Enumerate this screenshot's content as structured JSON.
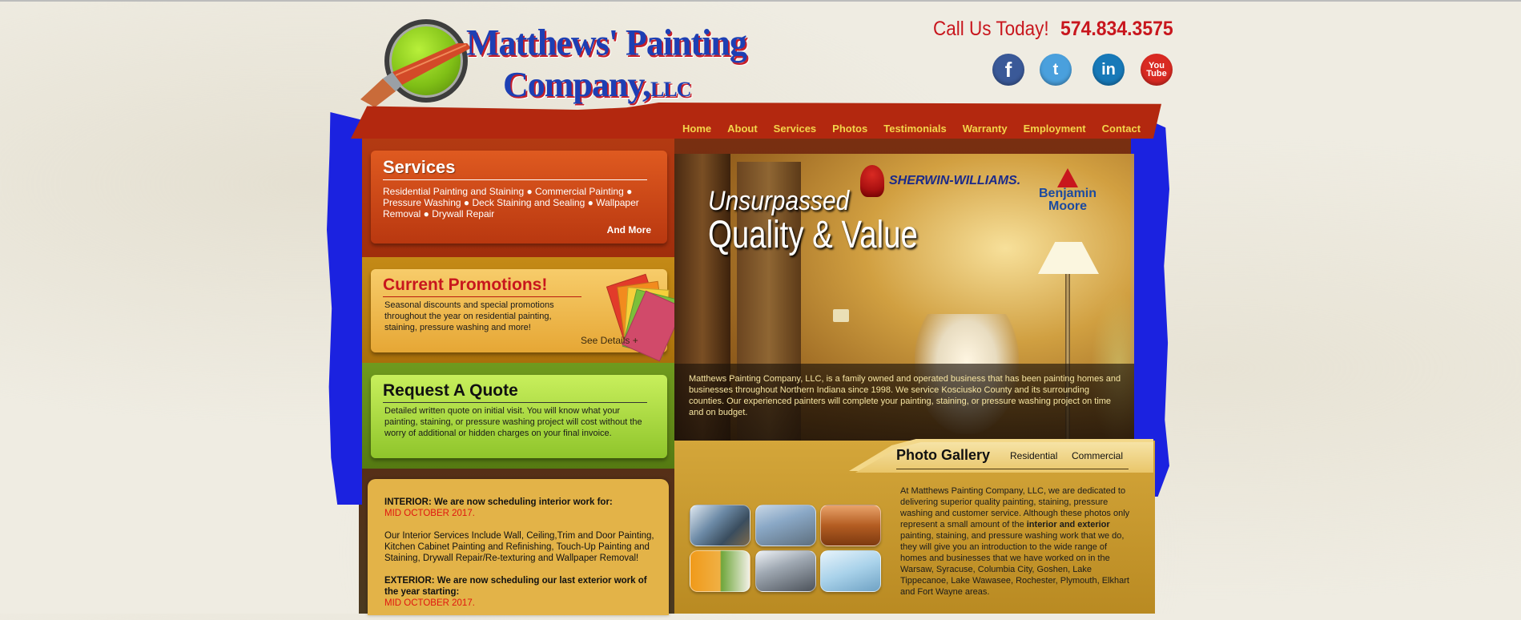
{
  "logo": {
    "line1": "Matthews' Painting",
    "line2": "Company,",
    "llc": "LLC"
  },
  "header": {
    "call_label": "Call Us Today!",
    "phone": "574.834.3575",
    "social": {
      "facebook": "f",
      "twitter": "t",
      "linkedin": "in",
      "youtube_top": "You",
      "youtube_bottom": "Tube"
    }
  },
  "nav": {
    "items": [
      "Home",
      "About",
      "Services",
      "Photos",
      "Testimonials",
      "Warranty",
      "Employment",
      "Contact"
    ]
  },
  "services": {
    "title": "Services",
    "text": "Residential Painting and Staining ● Commercial Painting ● Pressure Washing ● Deck Staining and Sealing ● Wallpaper Removal ● Drywall Repair",
    "more": "And More"
  },
  "promotions": {
    "title": "Current Promotions!",
    "text": "Seasonal discounts and special promotions throughout the year on residential painting, staining, pressure washing and more!",
    "more": "See Details +"
  },
  "quote": {
    "title": "Request A Quote",
    "text": "Detailed written quote on initial visit. You will know what your painting, staining, or pressure washing project will cost without the worry of additional or hidden charges on your final invoice."
  },
  "hero": {
    "tagline1": "Unsurpassed",
    "tagline2": "Quality & Value",
    "brand1": "SHERWIN-WILLIAMS.",
    "brand2_line1": "Benjamin",
    "brand2_line2": "Moore",
    "caption": "Matthews Painting Company, LLC, is a family owned and operated business that has been painting homes and businesses throughout Northern Indiana since 1998. We service Kosciusko County and its surrounding counties. Our experienced painters will complete your painting, staining, or pressure washing project on time and on budget."
  },
  "gallery": {
    "title": "Photo Gallery",
    "tab_residential": "Residential",
    "tab_commercial": "Commercial",
    "text_a": "At Matthews Painting Company, LLC, we are dedicated to delivering superior quality painting, staining, pressure washing and customer service. Although these photos only represent a small amount of the ",
    "text_bold": "interior and exterior",
    "text_b": " painting, staining, and pressure washing work that we do, they will give you an introduction to the wide range of homes and businesses that we have worked on in the Warsaw, Syracuse, Columbia City, Goshen, Lake Tippecanoe, Lake Wawasee, Rochester, Plymouth, Elkhart and Fort Wayne areas."
  },
  "schedule": {
    "interior_label": "INTERIOR: We are now scheduling interior work for:",
    "interior_date": "MID OCTOBER 2017.",
    "interior_services": "Our Interior Services Include Wall, Ceiling,Trim and Door Painting, Kitchen Cabinet Painting and Refinishing, Touch-Up Painting and Staining, Drywall Repair/Re-texturing and Wallpaper Removal!",
    "exterior_label": "EXTERIOR: We are now scheduling our last exterior work of the year starting:",
    "exterior_date": "MID OCTOBER 2017."
  },
  "colors": {
    "accent_red": "#c8161d",
    "frame_blue": "#1b22e0",
    "nav_text": "#f3d54b"
  }
}
